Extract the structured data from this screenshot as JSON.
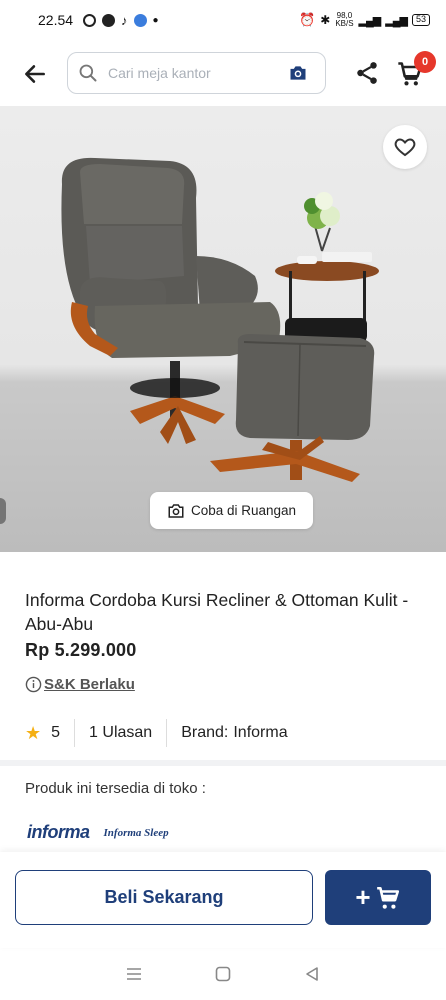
{
  "status_bar": {
    "time": "22.54",
    "net_speed_value": "98,0",
    "net_speed_unit": "KB/S",
    "battery": "53"
  },
  "header": {
    "search_placeholder": "Cari meja kantor",
    "cart_count": "0"
  },
  "hero": {
    "try_in_room_label": "Coba di Ruangan"
  },
  "product": {
    "title": "Informa Cordoba Kursi Recliner & Ottoman Kulit - Abu-Abu",
    "price": "Rp 5.299.000",
    "tnc_label": "S&K Berlaku",
    "rating": "5",
    "reviews": "1 Ulasan",
    "brand_label": "Brand:",
    "brand_value": "Informa"
  },
  "availability": {
    "label": "Produk ini tersedia di toko :",
    "stores": [
      "informa",
      "Informa Sleep"
    ]
  },
  "actions": {
    "buy_now_label": "Beli Sekarang",
    "add_to_cart_symbol": "+"
  },
  "colors": {
    "brand_navy": "#1f3f7a",
    "badge_red": "#e6372b",
    "star_yellow": "#f5b014"
  }
}
